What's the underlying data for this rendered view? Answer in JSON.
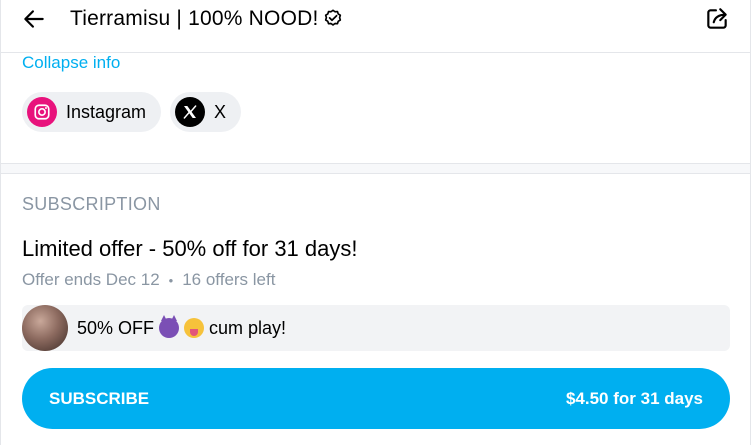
{
  "header": {
    "title": "Tierramisu | 100% NOOD!"
  },
  "info": {
    "collapse_label": "Collapse info"
  },
  "socials": [
    {
      "label": "Instagram",
      "icon": "instagram-icon",
      "color": "#e8127c"
    },
    {
      "label": "X",
      "icon": "x-icon",
      "color": "#000000"
    }
  ],
  "subscription": {
    "heading": "SUBSCRIPTION",
    "offer_title": "Limited offer - 50% off for 31 days!",
    "offer_ends": "Offer ends Dec 12",
    "offers_left": "16 offers left",
    "promo_text_before": "50% OFF",
    "promo_text_after": "cum play!",
    "button_label": "SUBSCRIBE",
    "button_price": "$4.50 for 31 days"
  },
  "colors": {
    "accent": "#00aff0",
    "muted_text": "#8a96a3"
  }
}
